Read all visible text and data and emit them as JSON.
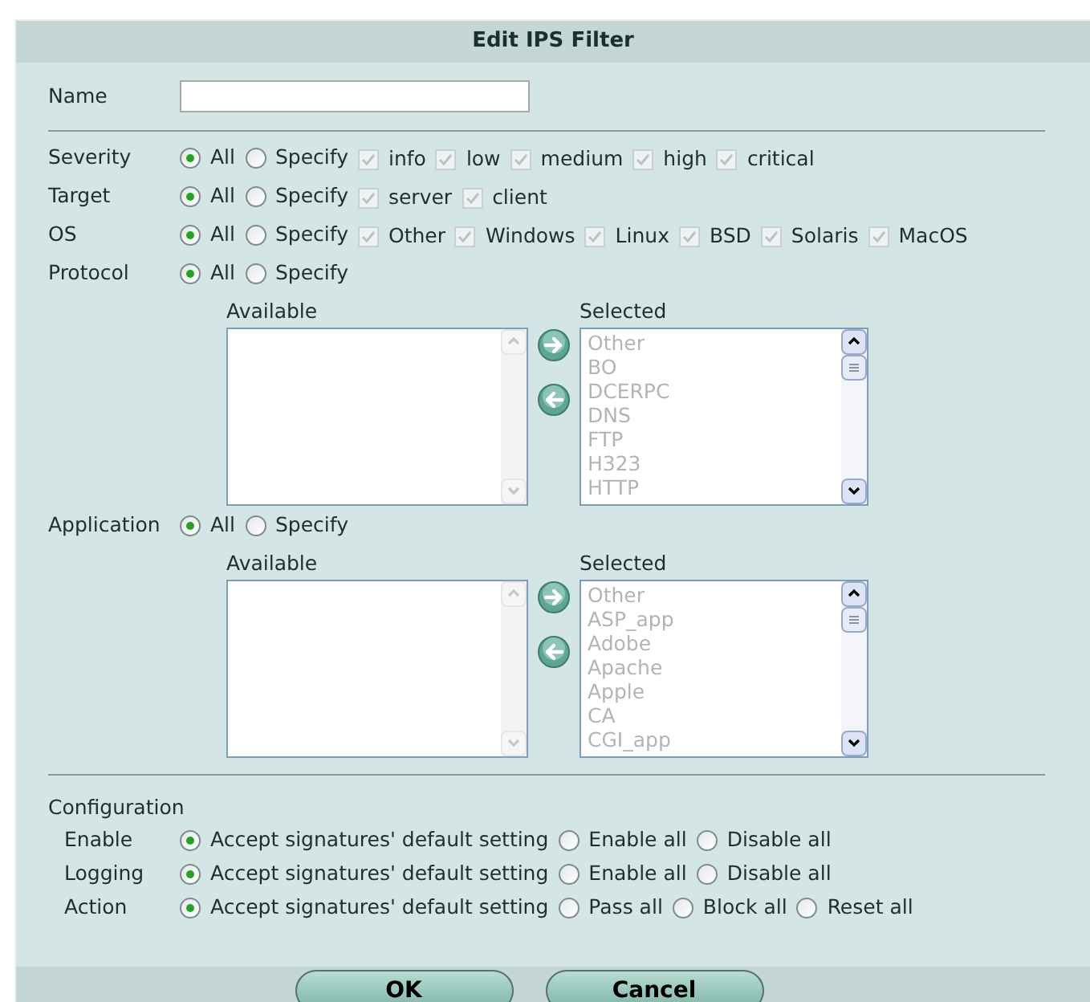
{
  "title": "Edit IPS Filter",
  "name_field": {
    "label": "Name"
  },
  "filters": [
    {
      "label": "Severity",
      "options": [
        {
          "label": "All",
          "selected": true
        },
        {
          "label": "Specify",
          "selected": false
        }
      ],
      "checkboxes": [
        {
          "label": "info",
          "checked": true,
          "disabled": true
        },
        {
          "label": "low",
          "checked": true,
          "disabled": true
        },
        {
          "label": "medium",
          "checked": true,
          "disabled": true
        },
        {
          "label": "high",
          "checked": true,
          "disabled": true
        },
        {
          "label": "critical",
          "checked": true,
          "disabled": true
        }
      ]
    },
    {
      "label": "Target",
      "options": [
        {
          "label": "All",
          "selected": true
        },
        {
          "label": "Specify",
          "selected": false
        }
      ],
      "checkboxes": [
        {
          "label": "server",
          "checked": true,
          "disabled": true
        },
        {
          "label": "client",
          "checked": true,
          "disabled": true
        }
      ]
    },
    {
      "label": "OS",
      "options": [
        {
          "label": "All",
          "selected": true
        },
        {
          "label": "Specify",
          "selected": false
        }
      ],
      "checkboxes": [
        {
          "label": "Other",
          "checked": true,
          "disabled": true
        },
        {
          "label": "Windows",
          "checked": true,
          "disabled": true
        },
        {
          "label": "Linux",
          "checked": true,
          "disabled": true
        },
        {
          "label": "BSD",
          "checked": true,
          "disabled": true
        },
        {
          "label": "Solaris",
          "checked": true,
          "disabled": true
        },
        {
          "label": "MacOS",
          "checked": true,
          "disabled": true
        }
      ]
    },
    {
      "label": "Protocol",
      "options": [
        {
          "label": "All",
          "selected": true
        },
        {
          "label": "Specify",
          "selected": false
        }
      ],
      "lists": {
        "available_label": "Available",
        "selected_label": "Selected",
        "disabled": true,
        "selected_items": [
          "Other",
          "BO",
          "DCERPC",
          "DNS",
          "FTP",
          "H323",
          "HTTP"
        ]
      }
    },
    {
      "label": "Application",
      "options": [
        {
          "label": "All",
          "selected": true
        },
        {
          "label": "Specify",
          "selected": false
        }
      ],
      "lists": {
        "available_label": "Available",
        "selected_label": "Selected",
        "disabled": true,
        "selected_items": [
          "Other",
          "ASP_app",
          "Adobe",
          "Apache",
          "Apple",
          "CA",
          "CGI_app"
        ]
      }
    }
  ],
  "configuration": {
    "label": "Configuration",
    "rows": [
      {
        "label": "Enable",
        "options": [
          {
            "label": "Accept signatures' default setting",
            "selected": true
          },
          {
            "label": "Enable all",
            "selected": false
          },
          {
            "label": "Disable all",
            "selected": false
          }
        ]
      },
      {
        "label": "Logging",
        "options": [
          {
            "label": "Accept signatures' default setting",
            "selected": true
          },
          {
            "label": "Enable all",
            "selected": false
          },
          {
            "label": "Disable all",
            "selected": false
          }
        ]
      },
      {
        "label": "Action",
        "options": [
          {
            "label": "Accept signatures' default setting",
            "selected": true
          },
          {
            "label": "Pass all",
            "selected": false
          },
          {
            "label": "Block all",
            "selected": false
          },
          {
            "label": "Reset all",
            "selected": false
          }
        ]
      }
    ]
  },
  "buttons": [
    "OK",
    "Cancel"
  ]
}
